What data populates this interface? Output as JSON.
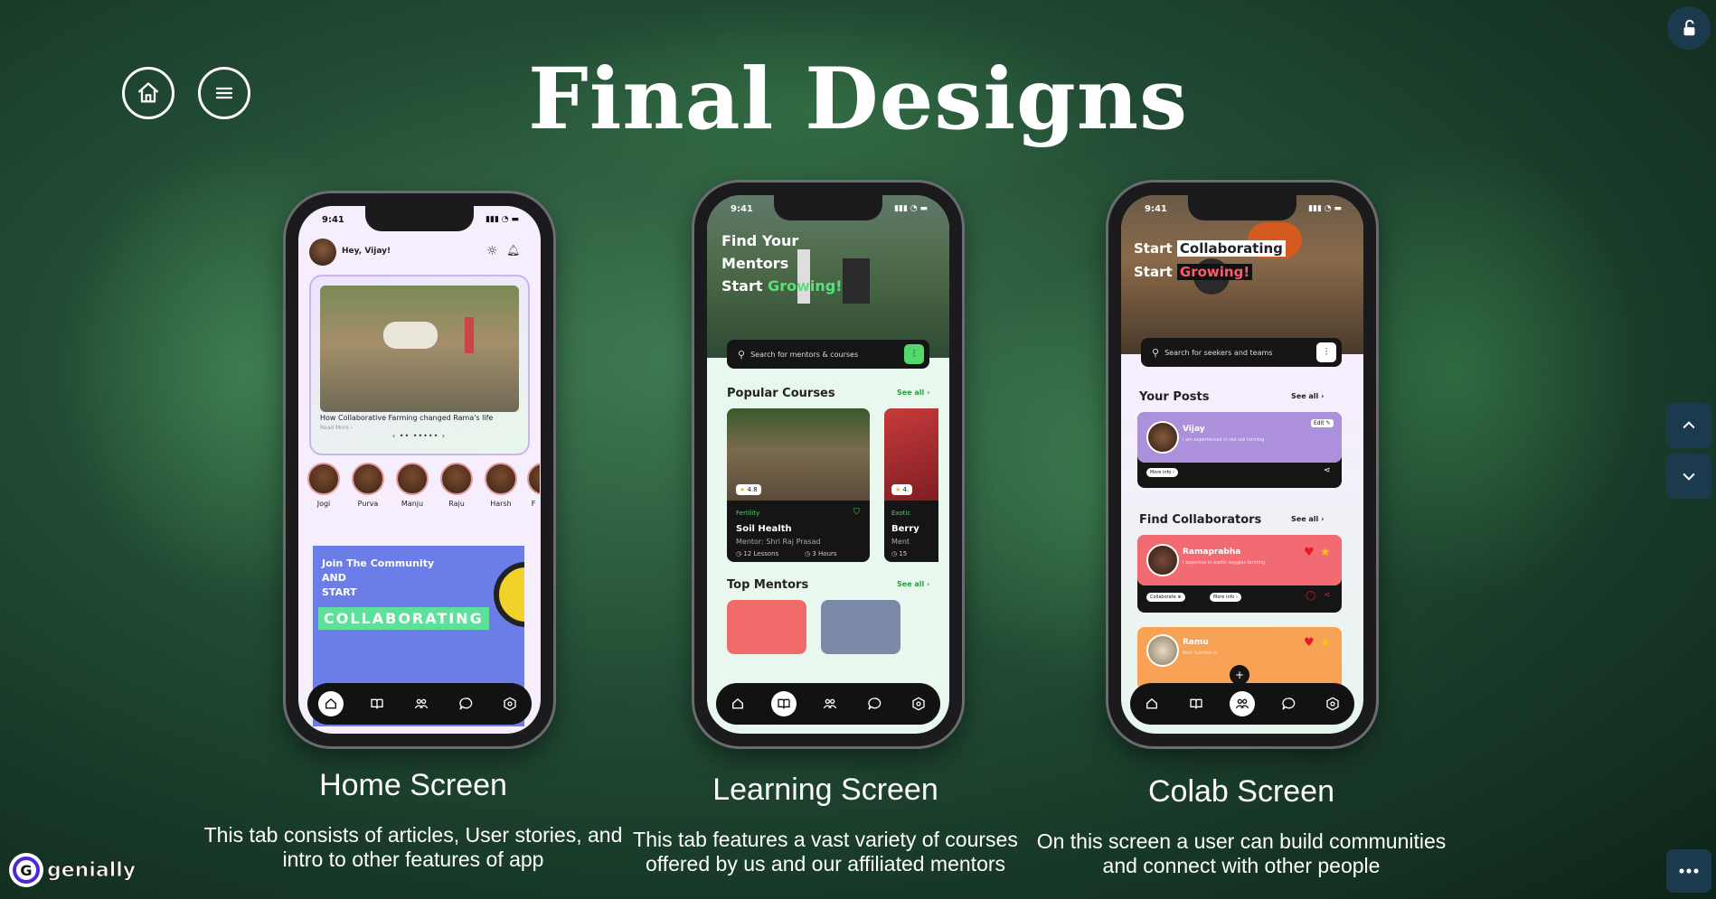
{
  "page": {
    "title": "Final Designs"
  },
  "nav": {
    "home_icon": "home-icon",
    "menu_icon": "menu-icon"
  },
  "side": {
    "lock_icon": "unlock-icon",
    "up_icon": "chevron-up-icon",
    "down_icon": "chevron-down-icon",
    "more_icon": "more-icon"
  },
  "brand": {
    "logo_text": "genially"
  },
  "screens": [
    {
      "title": "Home Screen",
      "description_l1": "This tab consists of articles, User stories, and",
      "description_l2": "intro to other features of app"
    },
    {
      "title": "Learning Screen",
      "description_l1": "This tab features a vast variety of courses",
      "description_l2": "offered by us and our affiliated mentors"
    },
    {
      "title": "Colab Screen",
      "description_l1": "On this screen a user can build communities",
      "description_l2": "and connect with other people"
    }
  ],
  "home": {
    "time": "9:41",
    "greeting": "Hey, Vijay!",
    "article_title": "How Collaborative Farming changed Rama's life",
    "read_more": "Read More ›",
    "stories": [
      "Jogi",
      "Purva",
      "Manju",
      "Raju",
      "Harsh",
      "F"
    ],
    "promo_l1": "Join The Community",
    "promo_l2": "AND",
    "promo_l3": "START",
    "promo_cta": "COLLABORATING"
  },
  "learning": {
    "time": "9:41",
    "hero_l1": "Find Your",
    "hero_l2": "Mentors",
    "hero_l3a": "Start ",
    "hero_l3b": "Growing!",
    "search_placeholder": "Search for mentors & courses",
    "popular_title": "Popular Courses",
    "see_all": "See all ›",
    "course": {
      "rating": "4.8",
      "category": "Fertility",
      "name": "Soil Health",
      "mentor": "Mentor: Shri Raj Prasad",
      "lessons": "12 Lessons",
      "hours": "3 Hours"
    },
    "course2": {
      "rating": "4.",
      "category": "Exotic",
      "name": "Berry",
      "mentor": "Ment",
      "lessons": "15"
    },
    "mentors_title": "Top Mentors"
  },
  "colab": {
    "time": "9:41",
    "hero_l1a": "Start",
    "hero_l1b": "Collaborating",
    "hero_l2a": "Start",
    "hero_l2b": "Growing!",
    "search_placeholder": "Search for seekers and teams",
    "posts_title": "Your Posts",
    "see_all": "See all ›",
    "post": {
      "name": "Vijay",
      "desc": "I am experienced in red soil farming",
      "edit": "Edit",
      "more": "More info ›"
    },
    "collab_title": "Find Collaborators",
    "collab1": {
      "name": "Ramaprabha",
      "desc": "I expertise in exotic veggies farming",
      "btn1": "Collaborate",
      "btn2": "More info"
    },
    "collab2": {
      "name": "Ramu",
      "desc": "Best Solution in"
    }
  }
}
